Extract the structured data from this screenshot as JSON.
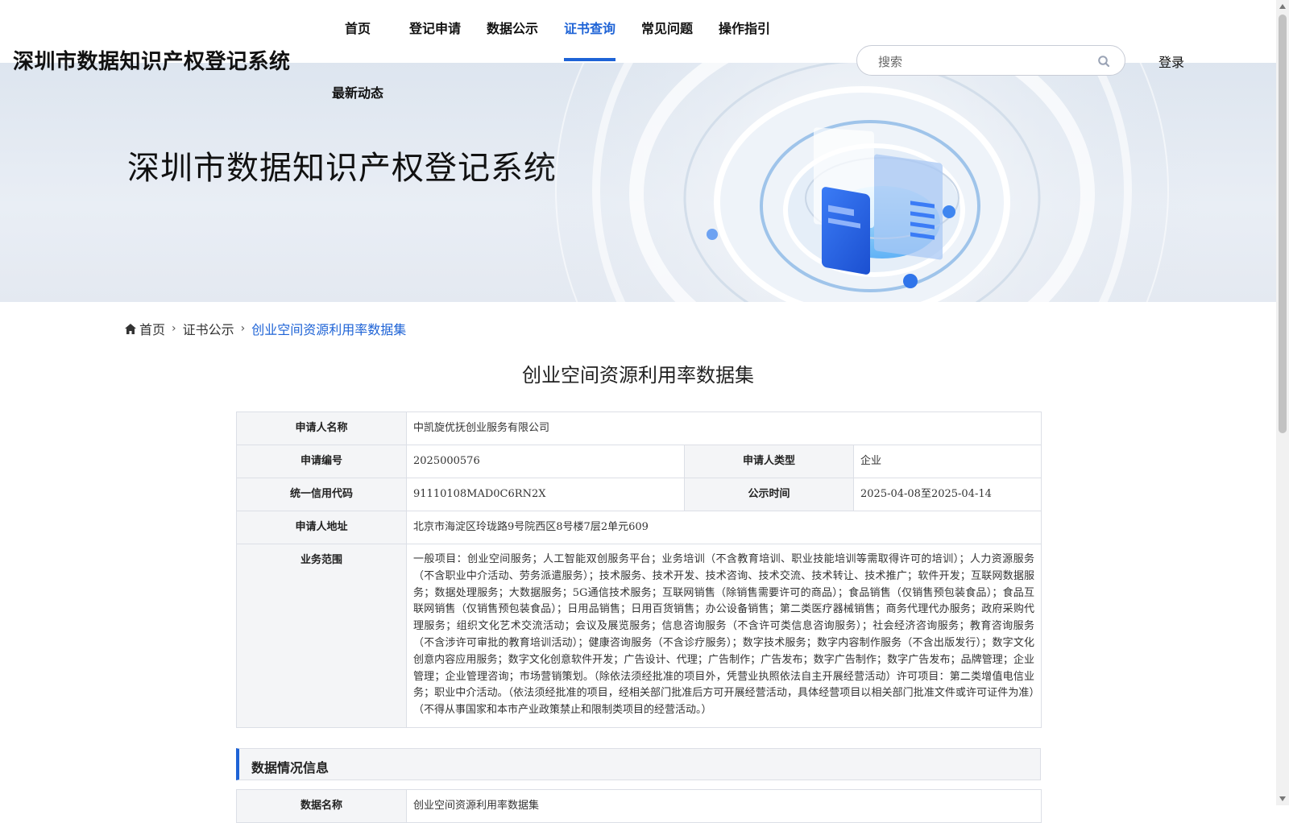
{
  "header": {
    "site_title": "深圳市数据知识产权登记系统",
    "nav": [
      {
        "label": "首页",
        "active": false
      },
      {
        "label": "登记申请",
        "active": false
      },
      {
        "label": "数据公示",
        "active": false
      },
      {
        "label": "证书查询",
        "active": true
      },
      {
        "label": "常见问题",
        "active": false
      },
      {
        "label": "操作指引",
        "active": false
      },
      {
        "label": "最新动态",
        "active": false
      }
    ],
    "search_placeholder": "搜索",
    "login_label": "登录"
  },
  "banner": {
    "title": "深圳市数据知识产权登记系统"
  },
  "breadcrumb": {
    "home": "首页",
    "parent": "证书公示",
    "current": "创业空间资源利用率数据集"
  },
  "page_title": "创业空间资源利用率数据集",
  "details": {
    "applicant_name_label": "申请人名称",
    "applicant_name": "中凯旋优抚创业服务有限公司",
    "application_no_label": "申请编号",
    "application_no": "2025000576",
    "applicant_type_label": "申请人类型",
    "applicant_type": "企业",
    "credit_code_label": "统一信用代码",
    "credit_code": "91110108MAD0C6RN2X",
    "publicity_time_label": "公示时间",
    "publicity_time": "2025-04-08至2025-04-14",
    "address_label": "申请人地址",
    "address": "北京市海淀区玲珑路9号院西区8号楼7层2单元609",
    "scope_label": "业务范围",
    "scope": "一般项目：创业空间服务；人工智能双创服务平台；业务培训（不含教育培训、职业技能培训等需取得许可的培训）；人力资源服务（不含职业中介活动、劳务派遣服务）；技术服务、技术开发、技术咨询、技术交流、技术转让、技术推广；软件开发；互联网数据服务；数据处理服务；大数据服务；5G通信技术服务；互联网销售（除销售需要许可的商品）；食品销售（仅销售预包装食品）；食品互联网销售（仅销售预包装食品）；日用品销售；日用百货销售；办公设备销售；第二类医疗器械销售；商务代理代办服务；政府采购代理服务；组织文化艺术交流活动；会议及展览服务；信息咨询服务（不含许可类信息咨询服务）；社会经济咨询服务；教育咨询服务（不含涉许可审批的教育培训活动）；健康咨询服务（不含诊疗服务）；数字技术服务；数字内容制作服务（不含出版发行）；数字文化创意内容应用服务；数字文化创意软件开发；广告设计、代理；广告制作；广告发布；数字广告制作；数字广告发布；品牌管理；企业管理；企业管理咨询；市场营销策划。（除依法须经批准的项目外，凭营业执照依法自主开展经营活动）许可项目：第二类增值电信业务；职业中介活动。（依法须经批准的项目，经相关部门批准后方可开展经营活动，具体经营项目以相关部门批准文件或许可证件为准）（不得从事国家和本市产业政策禁止和限制类项目的经营活动。）"
  },
  "data_section": {
    "title": "数据情况信息",
    "data_name_label": "数据名称",
    "data_name": "创业空间资源利用率数据集"
  },
  "colors": {
    "accent": "#1e63d6",
    "label_bg": "#f4f5f7",
    "border": "#dcdfe6"
  }
}
